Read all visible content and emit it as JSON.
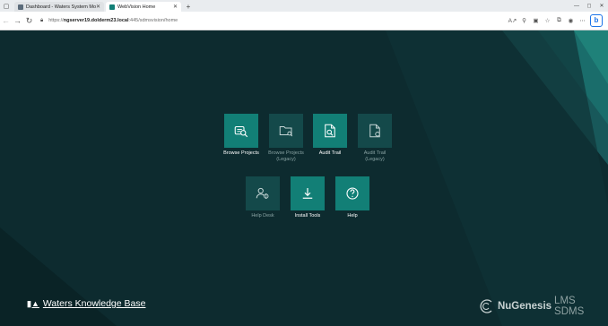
{
  "browser": {
    "tabs": [
      {
        "label": "Dashboard - Waters System Mo"
      },
      {
        "label": "WebVision Home"
      }
    ],
    "url": {
      "scheme": "https://",
      "host": "ngserver19.dolderm23.local",
      "path": ":445/sdmsvision/home"
    }
  },
  "tiles": [
    {
      "label": "Browse Projects",
      "sub": "",
      "active": true
    },
    {
      "label": "Browse Projects",
      "sub": "(Legacy)",
      "active": false
    },
    {
      "label": "Audit Trail",
      "sub": "",
      "active": true
    },
    {
      "label": "Audit Trail",
      "sub": "(Legacy)",
      "active": false
    },
    {
      "label": "Help Desk",
      "sub": "",
      "active": false
    },
    {
      "label": "Install Tools",
      "sub": "",
      "active": true
    },
    {
      "label": "Help",
      "sub": "",
      "active": true
    }
  ],
  "footer": {
    "knowledge_base": "Waters Knowledge Base",
    "brand_name": "NuGenesis",
    "brand_suffix": "LMS SDMS"
  },
  "colors": {
    "background": "#0d2b2f",
    "tile_active": "#127f76",
    "tile_inactive": "#14494a"
  }
}
